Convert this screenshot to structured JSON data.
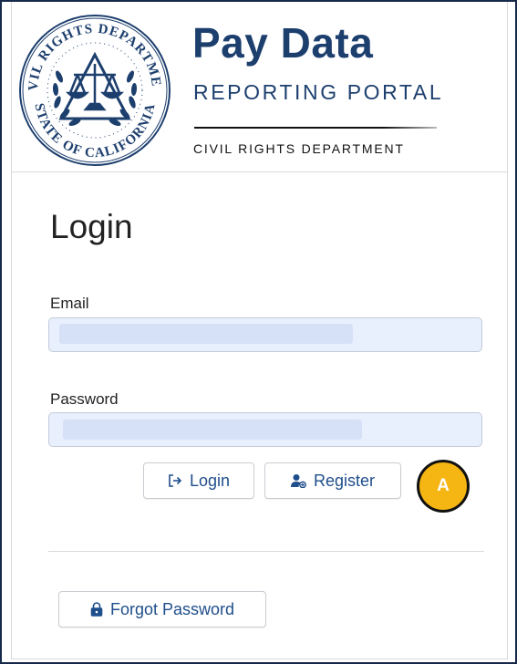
{
  "brand": {
    "title": "Pay Data",
    "subtitle": "REPORTING PORTAL",
    "department": "CIVIL RIGHTS DEPARTMENT",
    "seal_top_text": "CIVIL RIGHTS DEPARTMENT",
    "seal_bottom_text": "STATE OF CALIFORNIA",
    "seal_icon": "scales-of-justice-icon",
    "color": "#1d3f6e"
  },
  "login": {
    "heading": "Login",
    "email": {
      "label": "Email",
      "value": "",
      "value_redacted": true
    },
    "password": {
      "label": "Password",
      "value": "",
      "value_redacted": true
    },
    "login_button": {
      "label": "Login",
      "icon": "sign-in-icon"
    },
    "register_button": {
      "label": "Register",
      "icon": "user-add-icon"
    },
    "forgot_password_button": {
      "label": "Forgot Password",
      "icon": "lock-icon"
    }
  },
  "annotation": {
    "marker_label": "A",
    "marker_color": "#f5b512"
  },
  "colors": {
    "accent": "#1f4e8c",
    "input_fill": "#e8f0fe",
    "frame": "#16294a"
  }
}
